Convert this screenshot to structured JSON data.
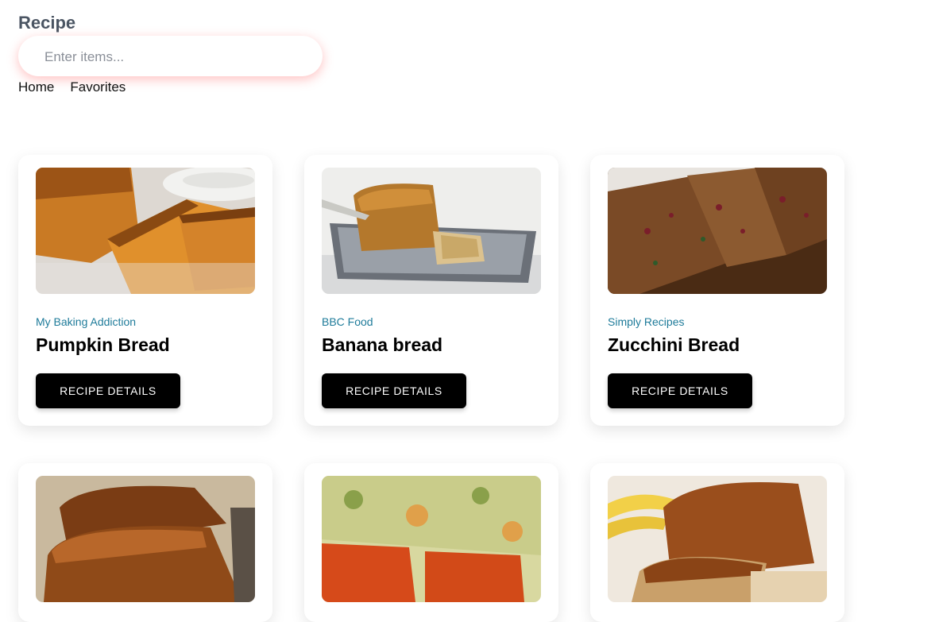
{
  "header": {
    "title": "Recipe"
  },
  "search": {
    "placeholder": "Enter items...",
    "value": ""
  },
  "nav": {
    "items": [
      {
        "label": "Home"
      },
      {
        "label": "Favorites"
      }
    ]
  },
  "recipes": [
    {
      "source": "My Baking Addiction",
      "title": "Pumpkin Bread",
      "button": "RECIPE DETAILS",
      "image": "pumpkin-bread-photo"
    },
    {
      "source": "BBC Food",
      "title": "Banana bread",
      "button": "RECIPE DETAILS",
      "image": "banana-bread-photo"
    },
    {
      "source": "Simply Recipes",
      "title": "Zucchini Bread",
      "button": "RECIPE DETAILS",
      "image": "zucchini-bread-photo"
    },
    {
      "source": "",
      "title": "",
      "button": "",
      "image": "loaf-bread-photo"
    },
    {
      "source": "",
      "title": "",
      "button": "",
      "image": "cheese-bread-photo"
    },
    {
      "source": "",
      "title": "",
      "button": "",
      "image": "banana-loaf-photo"
    }
  ],
  "colors": {
    "source_link": "#1e7b9a",
    "button_bg": "#000000",
    "search_glow": "#ff7878"
  }
}
